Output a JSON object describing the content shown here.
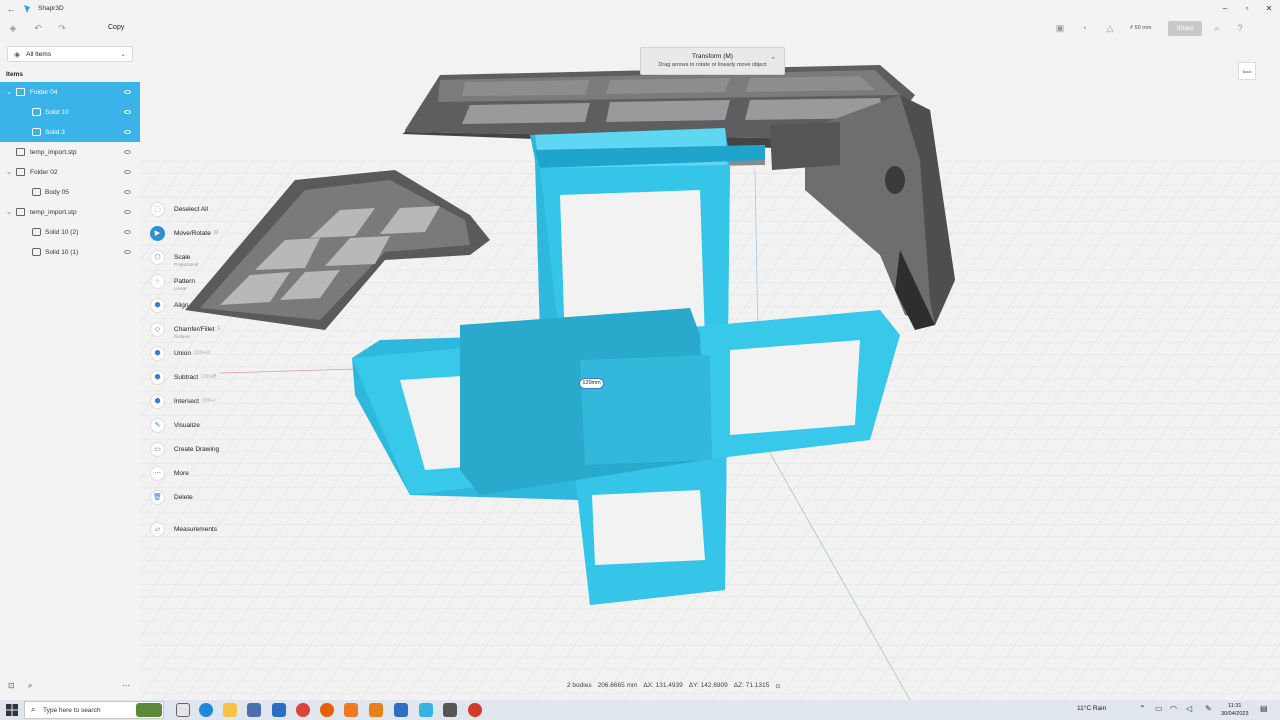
{
  "window": {
    "title": "Shapr3D"
  },
  "toolbar": {
    "copy_label": "Copy",
    "grid_size": "# 50 mm",
    "share_label": "Share"
  },
  "sidebar": {
    "filter_label": "All Items",
    "items_header": "Items",
    "items": [
      {
        "label": "Folder 04",
        "type": "folder",
        "selected": true
      },
      {
        "label": "Solid 10",
        "type": "solid",
        "selected": true
      },
      {
        "label": "Solid 3",
        "type": "solid",
        "selected": true
      },
      {
        "label": "temp_import.stp",
        "type": "folder",
        "selected": false
      },
      {
        "label": "Folder 02",
        "type": "folder",
        "selected": false
      },
      {
        "label": "Body 05",
        "type": "solid",
        "selected": false
      },
      {
        "label": "temp_import.stp",
        "type": "folder",
        "selected": false
      },
      {
        "label": "Solid 10 (2)",
        "type": "solid",
        "selected": false
      },
      {
        "label": "Solid 10 (1)",
        "type": "solid",
        "selected": false
      }
    ]
  },
  "context_menu": {
    "items": [
      {
        "label": "Deselect All",
        "icon": "deselect-icon"
      },
      {
        "label": "Move/Rotate",
        "shortcut": "M",
        "icon": "move-rotate-icon",
        "active": true
      },
      {
        "label": "Scale",
        "sub": "Proportional",
        "icon": "scale-icon"
      },
      {
        "label": "Pattern",
        "sub": "Linear",
        "icon": "pattern-icon"
      },
      {
        "label": "Align",
        "icon": "align-icon"
      },
      {
        "label": "Chamfer/Fillet",
        "shortcut": "F",
        "sub": "Rollover",
        "icon": "chamfer-fillet-icon"
      },
      {
        "label": "Union",
        "shortcut": "Ctrl+U",
        "icon": "union-icon"
      },
      {
        "label": "Subtract",
        "shortcut": "Ctrl+B",
        "icon": "subtract-icon"
      },
      {
        "label": "Intersect",
        "shortcut": "Ctrl+I",
        "icon": "intersect-icon"
      },
      {
        "label": "Visualize",
        "icon": "visualize-icon"
      },
      {
        "label": "Create Drawing",
        "icon": "drawing-icon"
      },
      {
        "label": "More",
        "icon": "more-icon"
      },
      {
        "label": "Delete",
        "icon": "delete-icon"
      },
      {
        "label": "Measurements",
        "icon": "measurements-icon"
      }
    ]
  },
  "transform_tip": {
    "title": "Transform (M)",
    "hint": "Drag arrows to rotate or linearly move object"
  },
  "viewcube_label": "Back",
  "dimension_label": "120mm",
  "status": {
    "bodies": "2 bodies",
    "length": "206.6665 mm",
    "dx": "ΔX: 131.4939",
    "dy": "ΔY: 142.6909",
    "dz": "ΔZ: 71.1315"
  },
  "taskbar": {
    "search_placeholder": "Type here to search",
    "weather": "11°C  Rain",
    "time": "11:31",
    "date": "30/04/2023"
  },
  "colors": {
    "accent": "#3ab3e8",
    "selected_solid": "#35c2e8",
    "grey_solid": "#6b6b6d"
  }
}
